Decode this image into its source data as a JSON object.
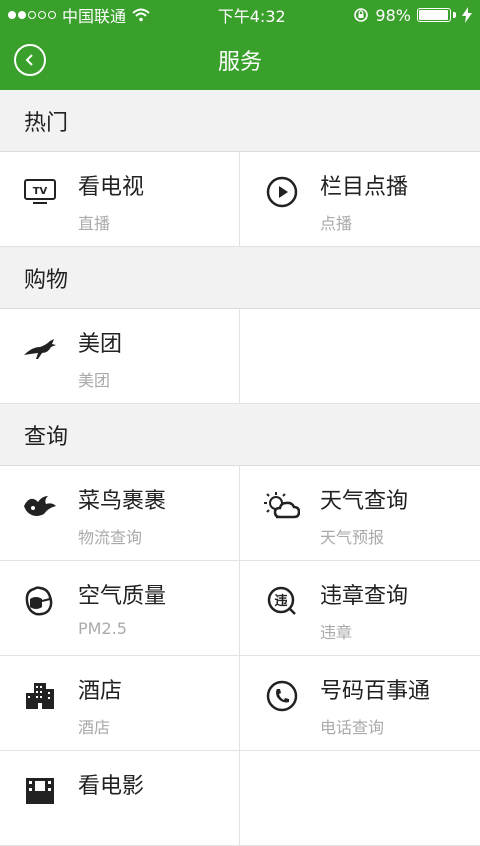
{
  "status": {
    "carrier": "中国联通",
    "time": "下午4:32",
    "battery": "98%",
    "battery_level": 0.98
  },
  "nav": {
    "title": "服务"
  },
  "sections": [
    {
      "title": "热门",
      "items": [
        {
          "title": "看电视",
          "subtitle": "直播",
          "icon": "tv-icon"
        },
        {
          "title": "栏目点播",
          "subtitle": "点播",
          "icon": "play-icon"
        }
      ]
    },
    {
      "title": "购物",
      "items": [
        {
          "title": "美团",
          "subtitle": "美团",
          "icon": "kangaroo-icon"
        }
      ]
    },
    {
      "title": "查询",
      "items": [
        {
          "title": "菜鸟裹裹",
          "subtitle": "物流查询",
          "icon": "bird-icon"
        },
        {
          "title": "天气查询",
          "subtitle": "天气预报",
          "icon": "weather-icon"
        },
        {
          "title": "空气质量",
          "subtitle": "PM2.5",
          "icon": "mask-icon"
        },
        {
          "title": "违章查询",
          "subtitle": "违章",
          "icon": "violation-icon"
        },
        {
          "title": "酒店",
          "subtitle": "酒店",
          "icon": "hotel-icon"
        },
        {
          "title": "号码百事通",
          "subtitle": "电话查询",
          "icon": "phone-icon"
        },
        {
          "title": "看电影",
          "subtitle": "",
          "icon": "cinema-icon"
        }
      ]
    }
  ],
  "colors": {
    "accent": "#3aa02c",
    "background": "#f2f2f2"
  }
}
